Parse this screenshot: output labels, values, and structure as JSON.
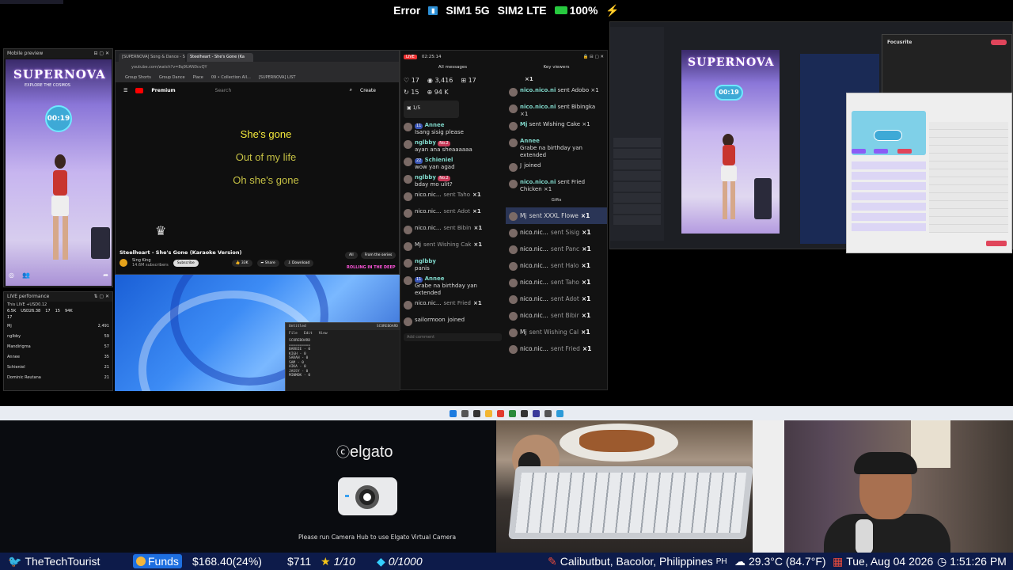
{
  "status_bar": {
    "error": "Error",
    "sim1": "SIM1 5G",
    "sim2": "SIM2 LTE",
    "battery": "100%",
    "charging_icon": "lightning-icon"
  },
  "mobile_preview": {
    "title": "Mobile preview",
    "banner": "SUPERNOVA",
    "banner_sub": "EXPLORE THE COSMOS",
    "timer": "00:19"
  },
  "live_performance": {
    "title": "LIVE performance",
    "subtitle": "This LIVE +USD0.12",
    "stats": [
      "6.5K",
      "USD26.38",
      "17",
      "15",
      "94K"
    ],
    "count": "17",
    "rows": [
      {
        "name": "Mj",
        "value": "2,491"
      },
      {
        "name": "nglbby",
        "value": "59"
      },
      {
        "name": "Mandirigma",
        "value": "57"
      },
      {
        "name": "Annee",
        "value": "35"
      },
      {
        "name": "Schieniel",
        "value": "21"
      },
      {
        "name": "Dominic Reutana",
        "value": "21"
      }
    ]
  },
  "browser": {
    "tabs": [
      "[SUPERNOVA] Song & Dance - Sco",
      "Steelheart - She's Gone (Ka"
    ],
    "url": "youtube.com/watch?v=8q9UAN0cvQY",
    "bookmarks": [
      "Group Shorts",
      "Group Dance",
      "Place",
      "09 • Collection AII...",
      "[SUPERNOVA] LIST"
    ],
    "yt_brand": "Premium",
    "search_placeholder": "Search",
    "create": "Create",
    "lyrics": [
      "She's gone",
      "Out of my life",
      "Oh she's gone"
    ],
    "video_title": "Steelheart - She's Gone (Karaoke Version)",
    "channel": "Sing King",
    "subscribers": "14.6M subscribers",
    "subscribe": "Subscribe",
    "likes": "33K",
    "share": "Share",
    "download": "Download",
    "filters": [
      "All",
      "From the series"
    ],
    "side_title": "ROLLING IN THE DEEP"
  },
  "notepad": {
    "title": "Untitled",
    "header_right": "SCOREBOARD",
    "menu": [
      "File",
      "Edit",
      "View"
    ],
    "lines": [
      "SCOREBOARD",
      "==========",
      "BARBIE - 0",
      "KIGH - 0",
      "SARAH - 0",
      "SAM - 0",
      "AIKA - 0",
      "JASSY - 0",
      "MINMOK - 0"
    ]
  },
  "chat_panel": {
    "time": "02:25:14",
    "all_messages": "All messages",
    "key_viewers": "Key viewers",
    "stats": {
      "likes": "17",
      "views": "3,416",
      "gifts": "17",
      "shares": "15",
      "followers": "94 K"
    },
    "poll": "1/5",
    "messages": [
      {
        "badge": "11",
        "name": "Annee",
        "text": "Isang sisig please"
      },
      {
        "badge": "No.2",
        "name": "nglbby",
        "text": "ayan ana sheaaaaaa"
      },
      {
        "badge": "22",
        "name": "Schieniel",
        "text": "wow yan agad"
      },
      {
        "badge": "No.2",
        "name": "nglbby",
        "text": "bday mo ulit?"
      },
      {
        "badge": "",
        "name": "nico.nic...",
        "text": "sent Taho",
        "gift": "×1"
      },
      {
        "badge": "",
        "name": "nico.nic...",
        "text": "sent Adot",
        "gift": "×1"
      },
      {
        "badge": "",
        "name": "nico.nic...",
        "text": "sent Bibin",
        "gift": "×1"
      },
      {
        "badge": "",
        "name": "Mj",
        "text": "sent Wishing Cak",
        "gift": "×1"
      },
      {
        "badge": "",
        "name": "nglbby",
        "text": "panis"
      },
      {
        "badge": "11",
        "name": "Annee",
        "text": "Grabe na birthday yan extended"
      },
      {
        "badge": "",
        "name": "nico.nic...",
        "text": "sent Fried",
        "gift": "×1"
      },
      {
        "badge": "",
        "name": "sailormoon",
        "text": "joined"
      }
    ],
    "comment_placeholder": "Add comment",
    "key_messages": [
      {
        "name": "",
        "text": "×1"
      },
      {
        "name": "nico.nico.ni",
        "text": "sent Adobo ×1"
      },
      {
        "name": "nico.nico.ni",
        "text": "sent Bibingka ×1"
      },
      {
        "name": "Mj",
        "text": "sent Wishing Cake ×1"
      },
      {
        "name": "Annee",
        "text": "Grabe na birthday yan extended"
      },
      {
        "name": "J",
        "text": "joined"
      },
      {
        "name": "nico.nico.ni",
        "text": "sent Fried Chicken ×1"
      }
    ],
    "gifts_label": "Gifts",
    "gifts": [
      {
        "name": "Mj",
        "text": "sent XXXL Flowe",
        "count": "×1"
      },
      {
        "name": "nico.nic...",
        "text": "sent Sisig",
        "count": "×1"
      },
      {
        "name": "nico.nic...",
        "text": "sent Panc",
        "count": "×1"
      },
      {
        "name": "nico.nic...",
        "text": "sent Halo",
        "count": "×1"
      },
      {
        "name": "nico.nic...",
        "text": "sent Taho",
        "count": "×1"
      },
      {
        "name": "nico.nic...",
        "text": "sent Adot",
        "count": "×1"
      },
      {
        "name": "nico.nic...",
        "text": "sent Bibir",
        "count": "×1"
      },
      {
        "name": "Mj",
        "text": "sent Wishing Cal",
        "count": "×1"
      },
      {
        "name": "nico.nic...",
        "text": "sent Fried",
        "count": "×1"
      }
    ]
  },
  "obs": {
    "banner": "SUPERNOVA",
    "timer": "00:19",
    "focus_title": "Focusrite"
  },
  "elgato": {
    "brand": "elgato",
    "message": "Please run Camera Hub to use Elgato Virtual Camera"
  },
  "ticker": {
    "handle": "TheTechTourist",
    "funds_label": "Funds",
    "funds_value": "$168.40(24%)",
    "price": "$711",
    "metric1": "1/10",
    "metric2": "0/1000",
    "location": "Calibutbut, Bacolor, Philippines",
    "country": "PH",
    "weather": "29.3°C (84.7°F)",
    "date": "Tue, Aug 04 2026",
    "time": "1:51:26 PM"
  },
  "colors": {
    "ticker_bg": "#0d1b4a",
    "lyric_active": "#f5ea3c",
    "lyric_dim": "#c6c144",
    "funds_bg": "#1e6fe0"
  }
}
